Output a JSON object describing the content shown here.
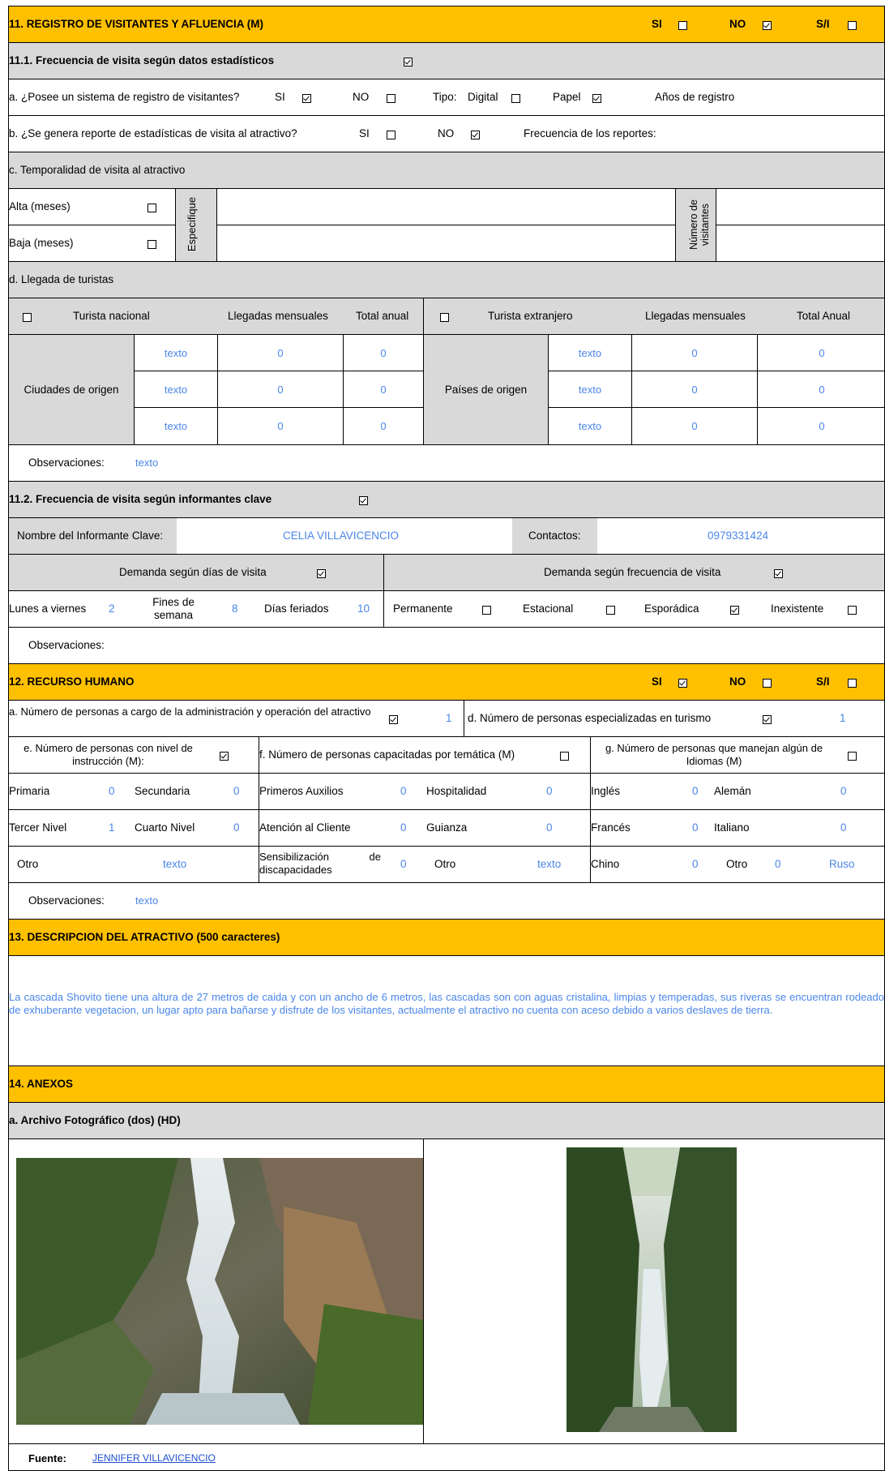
{
  "s11": {
    "title": "11. REGISTRO DE VISITANTES Y AFLUENCIA (M)",
    "si": "SI",
    "no": "NO",
    "sn": "S/I",
    "s111_title": "11.1. Frecuencia de visita según datos estadísticos",
    "a_question": "a. ¿Posee un sistema de registro de visitantes?",
    "tipo": "Tipo:",
    "digital": "Digital",
    "papel": "Papel",
    "anios": "Años de registro",
    "b_question": "b. ¿Se genera reporte de estadísticas de visita al atractivo?",
    "frecuencia_reportes": "Frecuencia de los reportes:",
    "c_title": "c. Temporalidad de visita al atractivo",
    "alta": "Alta (meses)",
    "baja": "Baja (meses)",
    "especifique": "Especifique",
    "numero_visitantes_1": "Número de",
    "numero_visitantes_2": "visitantes",
    "d_title": "d. Llegada de turistas",
    "turista_nacional": "Turista nacional",
    "llegadas_mensuales": "Llegadas mensuales",
    "total_anual": "Total anual",
    "turista_extranjero": "Turista extranjero",
    "total_anual_ext": "Total Anual",
    "ciudades": "Ciudades de origen",
    "paises": "Países de origen",
    "origin_rows": [
      {
        "n_name": "texto",
        "n_month": "0",
        "n_total": "0",
        "e_name": "texto",
        "e_month": "0",
        "e_total": "0"
      },
      {
        "n_name": "texto",
        "n_month": "0",
        "n_total": "0",
        "e_name": "texto",
        "e_month": "0",
        "e_total": "0"
      },
      {
        "n_name": "texto",
        "n_month": "0",
        "n_total": "0",
        "e_name": "texto",
        "e_month": "0",
        "e_total": "0"
      }
    ],
    "observaciones": "Observaciones:",
    "obs1_value": "texto",
    "s112_title": "11.2. Frecuencia de visita según informantes clave",
    "informante_label": "Nombre del Informante Clave:",
    "informante_value": "CELIA VILLAVICENCIO",
    "contactos_label": "Contactos:",
    "contactos_value": "0979331424",
    "demanda_dias": "Demanda según  días de visita",
    "demanda_frecuencia": "Demanda según frecuencia de visita",
    "lunes": "Lunes a viernes",
    "lunes_v": "2",
    "fines_1": "Fines de",
    "fines_2": "semana",
    "fines_v": "8",
    "feriados": "Días feriados",
    "feriados_v": "10",
    "permanente": "Permanente",
    "estacional": "Estacional",
    "esporadica": "Esporádica",
    "inexistente": "Inexistente",
    "observaciones2": "Observaciones:"
  },
  "s12": {
    "title": "12. RECURSO HUMANO",
    "si": "SI",
    "no": "NO",
    "sn": "S/I",
    "a_1": "a. Número de personas a cargo de la administración y operación del",
    "a_2": "atractivo",
    "a_v": "1",
    "d_label": "d. Número de personas especializadas en turismo",
    "d_v": "1",
    "e_1": "e. Número de personas con nivel de",
    "e_2": "instrucción (M):",
    "f_label": "f. Número de personas capacitadas por temática (M)",
    "g_1": "g. Número de personas que manejan algún de",
    "g_2": "Idiomas (M)",
    "primaria": "Primaria",
    "primaria_v": "0",
    "secundaria": "Secundaria",
    "secundaria_v": "0",
    "tercer": "Tercer Nivel",
    "tercer_v": "1",
    "cuarto": "Cuarto Nivel",
    "cuarto_v": "0",
    "otro_e": "Otro",
    "otro_e_v": "texto",
    "auxilios": "Primeros Auxilios",
    "auxilios_v": "0",
    "hospitalidad": "Hospitalidad",
    "hospitalidad_v": "0",
    "atencion": "Atención al Cliente",
    "atencion_v": "0",
    "guianza": "Guianza",
    "guianza_v": "0",
    "sensib_1": "Sensibilización",
    "sensib_de": "de",
    "sensib_2": "discapacidades",
    "sensib_v": "0",
    "otro_f": "Otro",
    "otro_f_v": "texto",
    "ingles": "Inglés",
    "ingles_v": "0",
    "aleman": "Alemán",
    "aleman_v": "0",
    "frances": "Francés",
    "frances_v": "0",
    "italiano": "Italiano",
    "italiano_v": "0",
    "chino": "Chino",
    "chino_v": "0",
    "otro_g": "Otro",
    "otro_g_v": "0",
    "otro_g_name": "Ruso",
    "observaciones": "Observaciones:",
    "obs_value": "texto"
  },
  "s13": {
    "title": "13. DESCRIPCION DEL ATRACTIVO (500 caracteres)",
    "description": "La cascada Shovito tiene una altura de 27 metros de caida y con un ancho de 6 metros, las cascadas son con aguas cristalina, limpias y temperadas, sus riveras se encuentran rodeado de exhuberante vegetacion,  un lugar apto para bañarse y disfrute de los visitantes, actualmente el atractivo no cuenta con aceso debido a varios deslaves de tierra."
  },
  "s14": {
    "title": "14. ANEXOS",
    "a_title": "a. Archivo Fotográfico (dos) (HD)",
    "fuente_label": "Fuente:",
    "fuente_value": "JENNIFER VILLAVICENCIO"
  },
  "checks": {
    "s11_si": false,
    "s11_no": true,
    "s11_sn": false,
    "s111": true,
    "a_si": true,
    "a_no": false,
    "a_digital": false,
    "a_papel": true,
    "b_si": false,
    "b_no": true,
    "alta": false,
    "baja": false,
    "nacional": false,
    "extranjero": false,
    "s112": true,
    "demanda_dias": true,
    "demanda_frecuencia": true,
    "permanente": false,
    "estacional": false,
    "esporadica": true,
    "inexistente": false,
    "s12_si": true,
    "s12_no": false,
    "s12_sn": false,
    "s12_a": true,
    "s12_d": true,
    "s12_e": true,
    "s12_f": false,
    "s12_g": false
  },
  "colors": {
    "header": "#FFC000",
    "subheader": "#D9D9D9",
    "value_text": "#4A86E8"
  }
}
